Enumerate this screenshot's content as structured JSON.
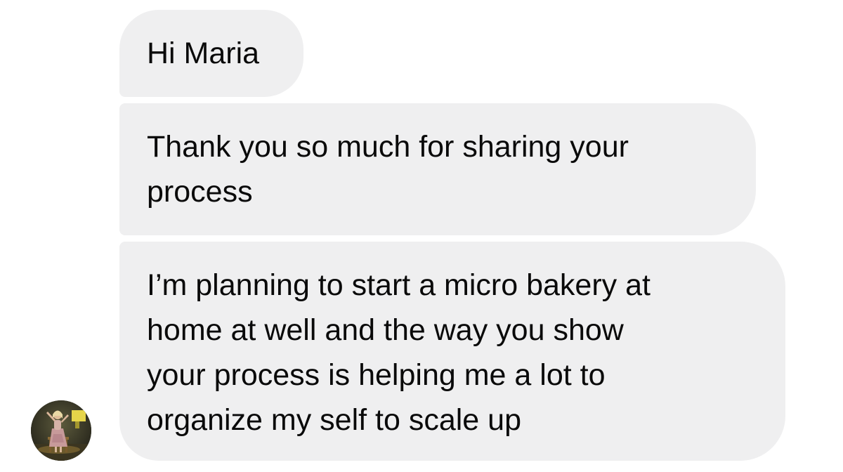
{
  "conversation": {
    "messages": [
      {
        "text": "Hi Maria"
      },
      {
        "text": "Thank you so much for sharing your\nprocess"
      },
      {
        "text": "I’m planning to start a micro bakery at\nhome at well and the way you show\nyour process is helping me a lot to\norganize my self to scale up"
      }
    ],
    "sender_avatar": {
      "icon": "profile-photo-avatar",
      "bubble_color": "#efeff0"
    }
  }
}
